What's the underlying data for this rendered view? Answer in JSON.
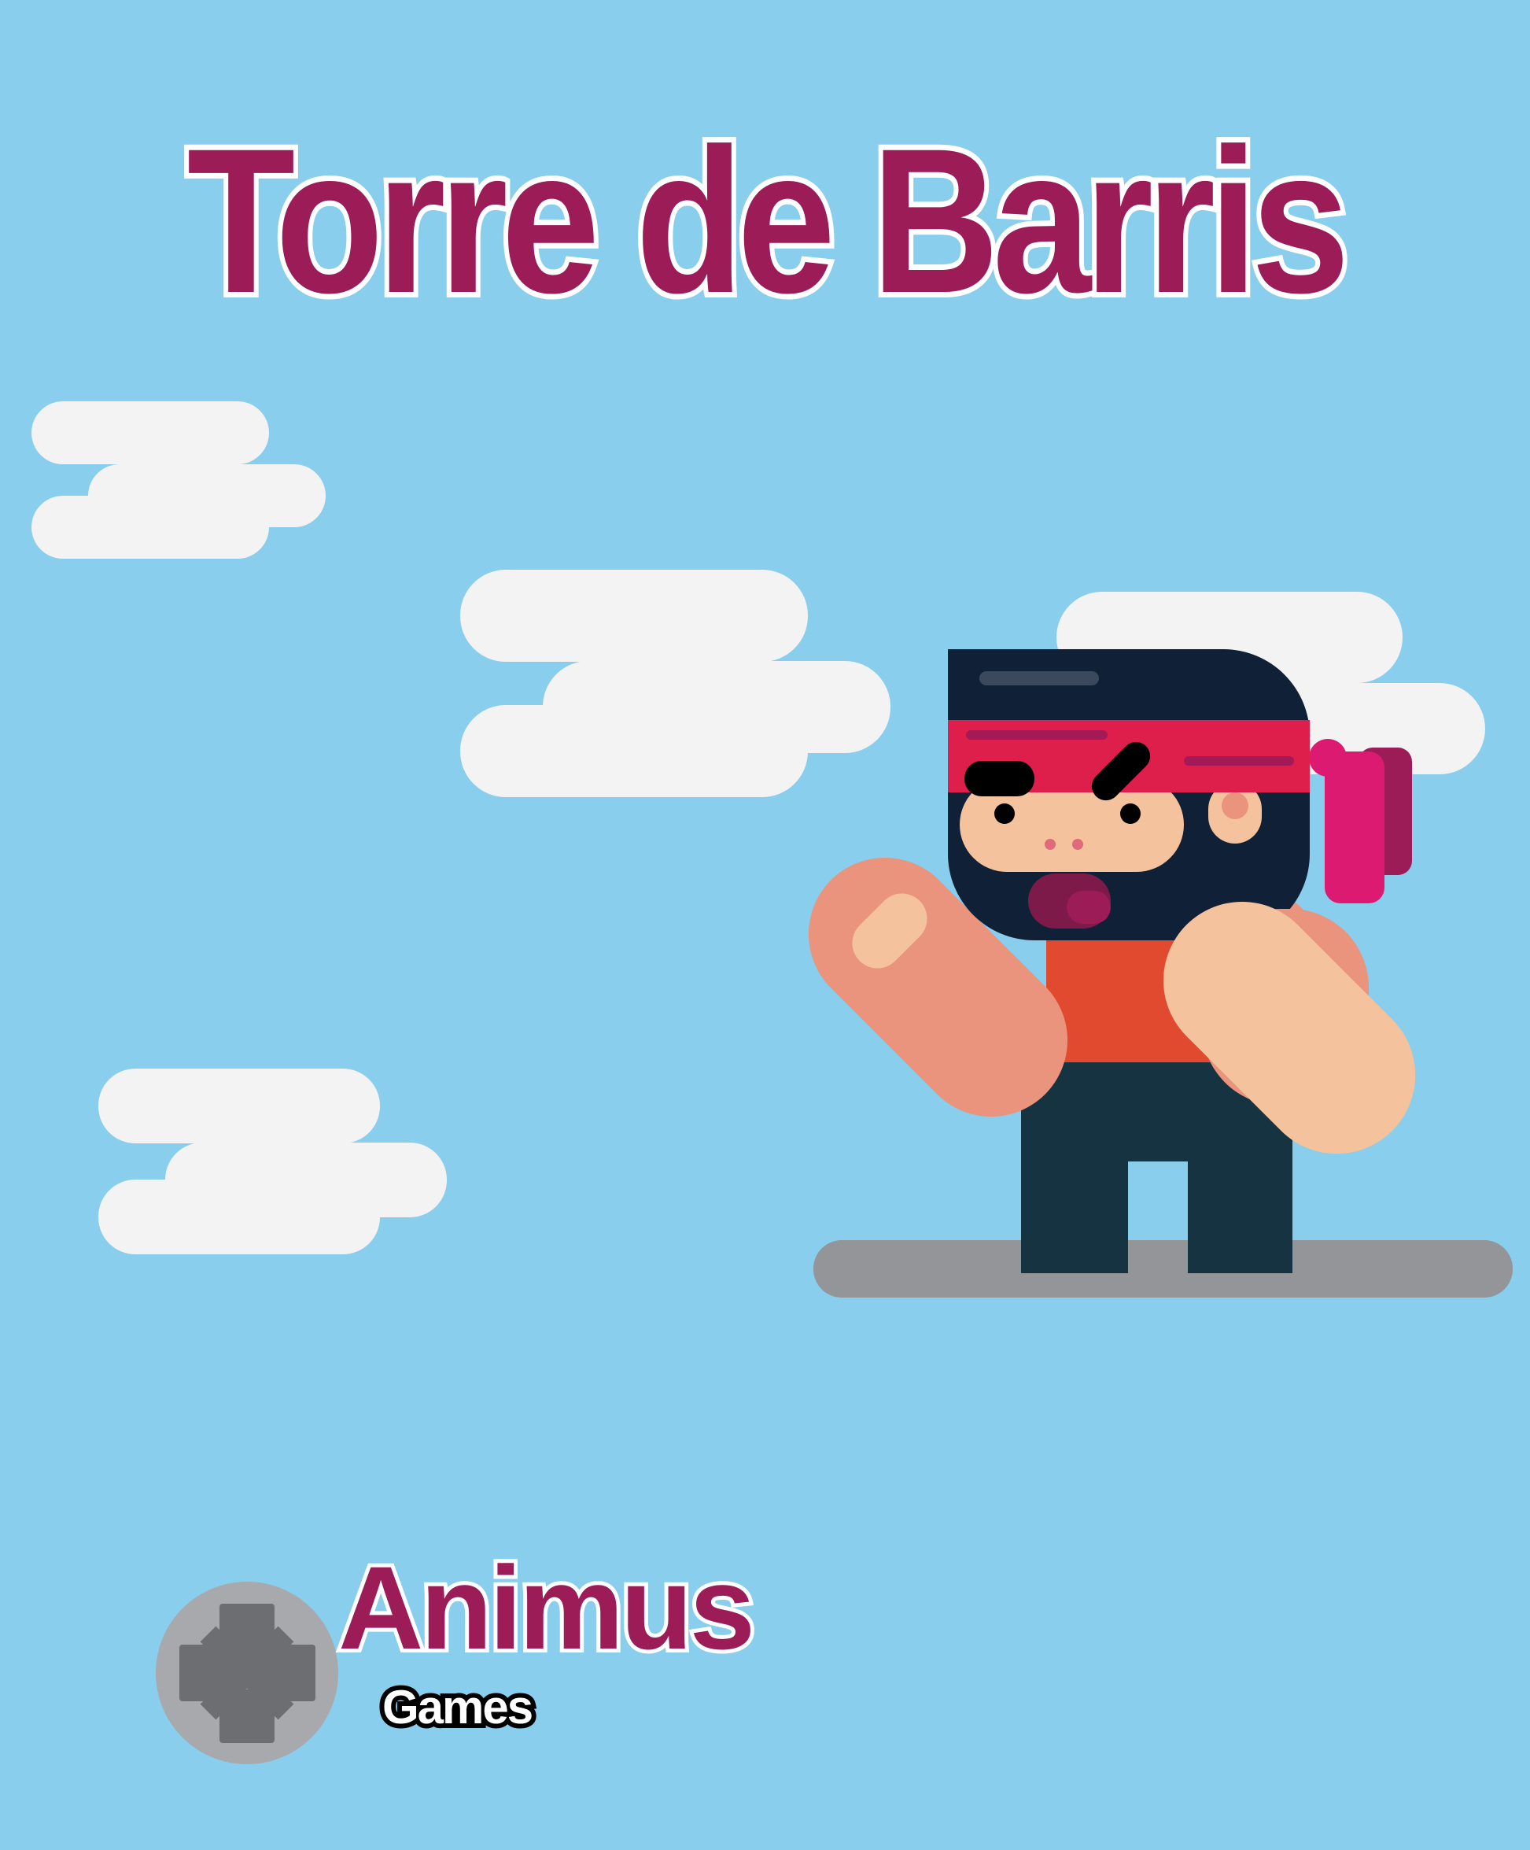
{
  "title": "Torre de Barris",
  "logo": {
    "name": "Animus",
    "subtitle": "Games",
    "icon": "dpad-icon"
  },
  "colors": {
    "sky": "#89ceed",
    "title": "#9c1c57",
    "cloud": "#f3f3f4",
    "ground": "#939598",
    "headband": "#de1f4b",
    "shirt": "#e24a2f",
    "pants": "#163342",
    "hood": "#102137",
    "skin": "#f4c29c"
  }
}
